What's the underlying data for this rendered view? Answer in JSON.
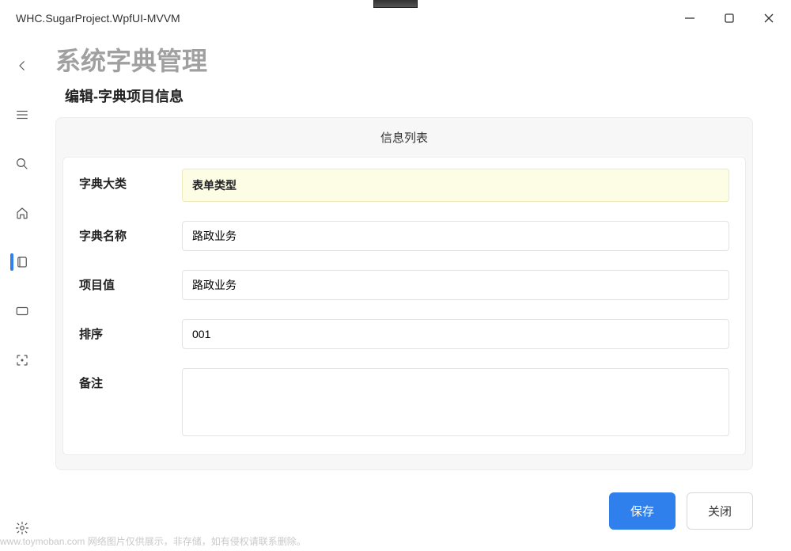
{
  "window": {
    "title": "WHC.SugarProject.WpfUI-MVVM"
  },
  "page": {
    "title": "系统字典管理",
    "subtitle": "编辑-字典项目信息",
    "card_header": "信息列表"
  },
  "form": {
    "category": {
      "label": "字典大类",
      "value": "表单类型"
    },
    "name": {
      "label": "字典名称",
      "value": "路政业务"
    },
    "item_value": {
      "label": "项目值",
      "value": "路政业务"
    },
    "sort": {
      "label": "排序",
      "value": "001"
    },
    "remark": {
      "label": "备注",
      "value": ""
    }
  },
  "buttons": {
    "save": "保存",
    "close": "关闭"
  },
  "footer": "www.toymoban.com 网络图片仅供展示，非存储，如有侵权请联系删除。"
}
